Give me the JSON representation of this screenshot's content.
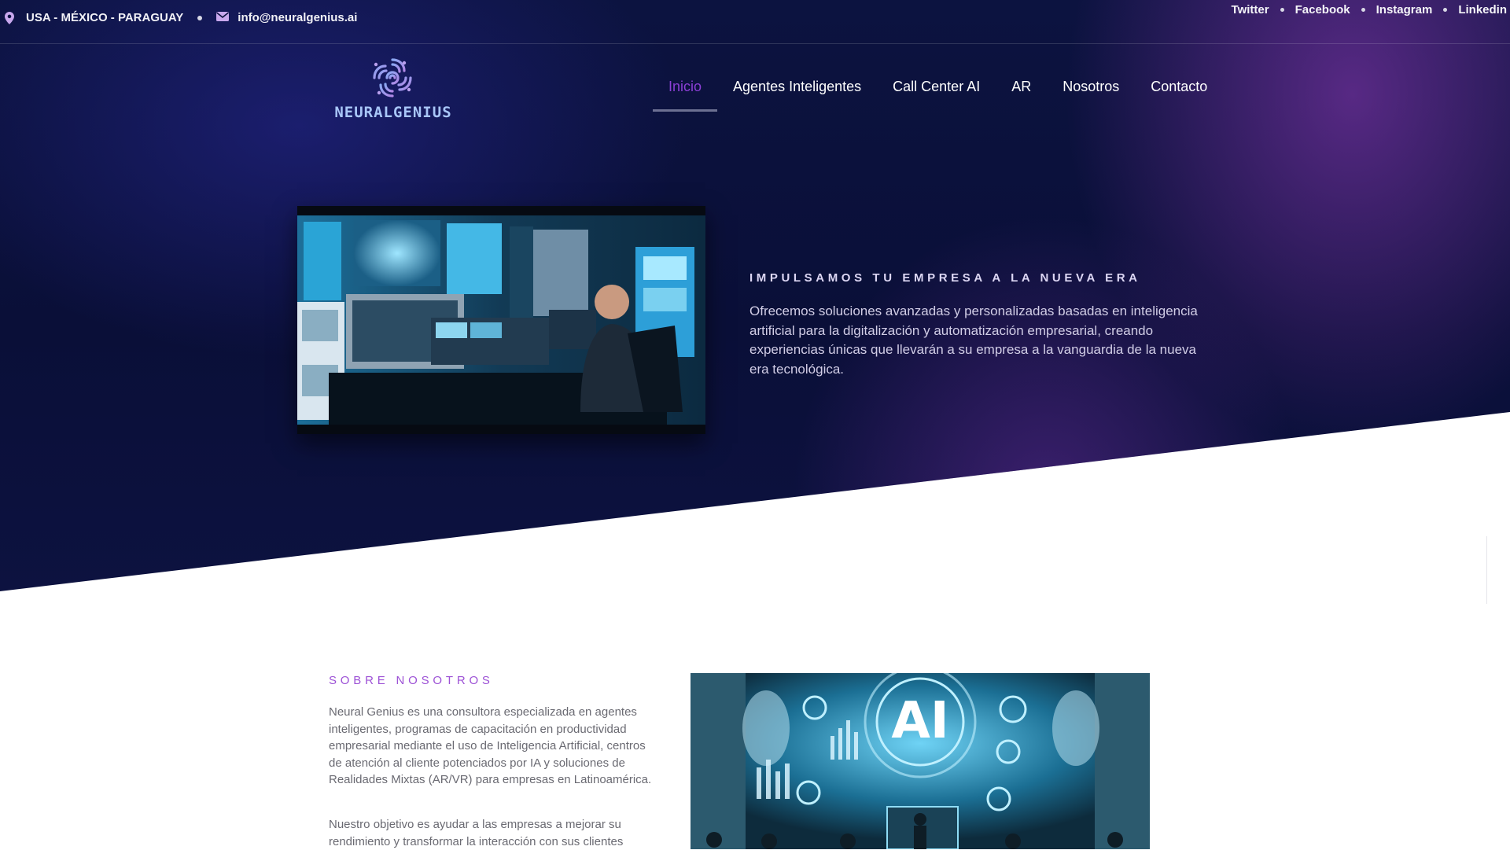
{
  "topbar": {
    "location": "USA - MÉXICO - PARAGUAY",
    "email": "info@neuralgenius.ai",
    "socials": [
      "Twitter",
      "Facebook",
      "Instagram",
      "Linkedin"
    ]
  },
  "brand": {
    "name": "NEURALGENIUS"
  },
  "nav": {
    "items": [
      {
        "label": "Inicio",
        "active": true
      },
      {
        "label": "Agentes Inteligentes"
      },
      {
        "label": "Call Center AI"
      },
      {
        "label": "AR"
      },
      {
        "label": "Nosotros"
      },
      {
        "label": "Contacto"
      }
    ]
  },
  "hero": {
    "kicker": "IMPULSAMOS TU EMPRESA A LA NUEVA ERA",
    "description": "Ofrecemos soluciones avanzadas y personalizadas basadas en inteligencia artificial para la digitalización y automatización empresarial, creando experiencias únicas que llevarán a su empresa a la vanguardia de la nueva era tecnológica."
  },
  "about": {
    "kicker": "SOBRE NOSOTROS",
    "paragraph1": "Neural Genius es una consultora especializada en agentes inteligentes, programas de capacitación en productividad empresarial mediante el uso de Inteligencia Artificial, centros de atención al cliente potenciados por IA y soluciones de Realidades Mixtas (AR/VR) para empresas en Latinoamérica.",
    "paragraph2": "Nuestro objetivo es ayudar a las empresas a mejorar su rendimiento y transformar la interacción con sus clientes",
    "image_text": "AI"
  },
  "colors": {
    "accent": "#8c3fd6",
    "kicker_purple": "#9d52d6",
    "hero_bg": "#0a0f38"
  }
}
